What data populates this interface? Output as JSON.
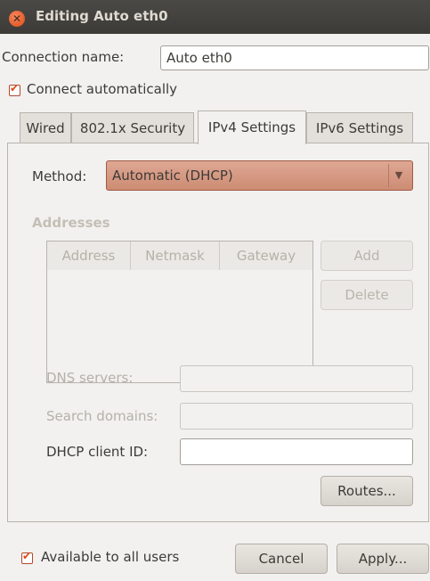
{
  "window": {
    "title": "Editing Auto eth0"
  },
  "connection": {
    "name_label": "Connection name:",
    "name_value": "Auto eth0",
    "connect_auto_label": "Connect automatically"
  },
  "tabs": [
    {
      "label": "Wired"
    },
    {
      "label": "802.1x Security"
    },
    {
      "label": "IPv4 Settings"
    },
    {
      "label": "IPv6 Settings"
    }
  ],
  "ipv4": {
    "method_label": "Method:",
    "method_value": "Automatic (DHCP)",
    "addresses_heading": "Addresses",
    "columns": [
      "Address",
      "Netmask",
      "Gateway"
    ],
    "add_label": "Add",
    "delete_label": "Delete",
    "dns_label": "DNS servers:",
    "search_label": "Search domains:",
    "dhcp_label": "DHCP client ID:",
    "routes_label": "Routes..."
  },
  "footer": {
    "all_users_label": "Available to all users",
    "cancel_label": "Cancel",
    "apply_label": "Apply..."
  },
  "colors": {
    "accent": "#df4a16",
    "titlebar": "#3c3b37",
    "combo": "#d49a84"
  }
}
